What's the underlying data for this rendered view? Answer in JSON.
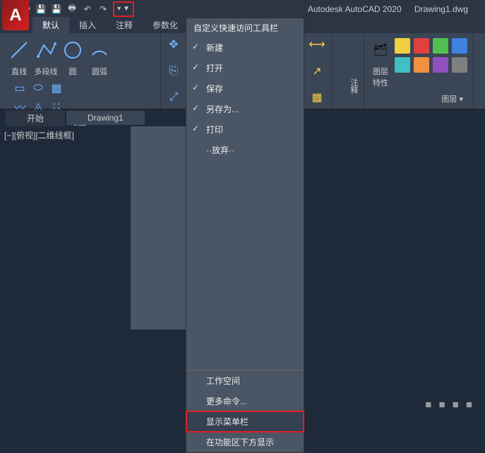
{
  "title": {
    "app": "Autodesk AutoCAD 2020",
    "doc": "Drawing1.dwg"
  },
  "logo": "A",
  "ribbon": {
    "tabs": [
      "默认",
      "插入",
      "注释",
      "参数化"
    ],
    "draw": {
      "line": "直线",
      "polyline": "多段线",
      "circle": "圆",
      "arc": "圆弧",
      "panel_label": "绘图 ▾"
    },
    "anno": {
      "label": "注释"
    },
    "layer": {
      "btn": "图层\n特性",
      "panel": "图层 ▾"
    }
  },
  "dropdown": {
    "header": "自定义快速访问工具栏",
    "items_checked": [
      "新建",
      "打开",
      "保存",
      "另存为...",
      "打印"
    ],
    "item_truncated": "··放弃··",
    "bottom": {
      "workspace": "工作空间",
      "more": "更多命令...",
      "menubar": "显示菜单栏",
      "below": "在功能区下方显示"
    }
  },
  "doctabs": {
    "start": "开始",
    "drawing": "Drawing1"
  },
  "viewport_label": "[−][俯视][二维线框]",
  "watermark": "■ ■ ■ ■"
}
